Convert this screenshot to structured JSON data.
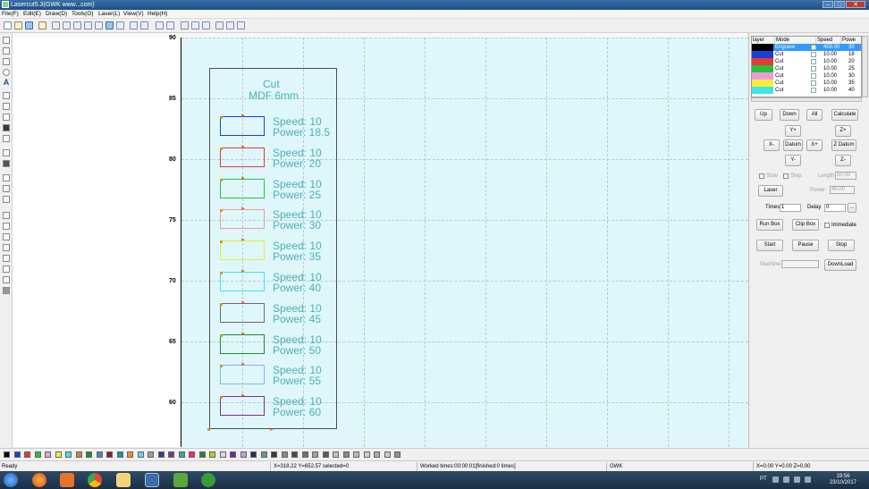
{
  "window": {
    "title": "Lasercut5.3(GWK www...com)",
    "min": "–",
    "max": "□",
    "close": "✕"
  },
  "menu": [
    "File(F)",
    "Edit(E)",
    "Draw(D)",
    "Tools(O)",
    "Laser(L)",
    "View(V)",
    "Help(H)"
  ],
  "ruler": {
    "labels": [
      "90",
      "85",
      "80",
      "75",
      "70",
      "65",
      "60"
    ]
  },
  "canvas": {
    "heading_line1": "Cut",
    "heading_line2": "MDF 6mm",
    "samples": [
      {
        "speed": "Speed: 10",
        "power": "Power: 18.5",
        "color": "#1a3fd6"
      },
      {
        "speed": "Speed: 10",
        "power": "Power: 20",
        "color": "#e53935"
      },
      {
        "speed": "Speed: 10",
        "power": "Power: 25",
        "color": "#22c33a"
      },
      {
        "speed": "Speed: 10",
        "power": "Power: 30",
        "color": "#ef9a9a"
      },
      {
        "speed": "Speed: 10",
        "power": "Power: 35",
        "color": "#e8e83a"
      },
      {
        "speed": "Speed: 10",
        "power": "Power: 40",
        "color": "#3ee6e6"
      },
      {
        "speed": "Speed: 10",
        "power": "Power: 45",
        "color": "#6b6b6b"
      },
      {
        "speed": "Speed: 10",
        "power": "Power: 50",
        "color": "#1e8c2a"
      },
      {
        "speed": "Speed: 10",
        "power": "Power: 55",
        "color": "#8fb0e0"
      },
      {
        "speed": "Speed: 10",
        "power": "Power: 60",
        "color": "#8a2a8a"
      }
    ]
  },
  "layers": {
    "headers": [
      "layer",
      "Mode",
      "Speed",
      "Powe"
    ],
    "rows": [
      {
        "color": "#000000",
        "mode": "Engrave",
        "speed": "400.00",
        "power": "30"
      },
      {
        "color": "#1a3fd6",
        "mode": "Cut",
        "speed": "10.00",
        "power": "18"
      },
      {
        "color": "#e53935",
        "mode": "Cut",
        "speed": "10.00",
        "power": "20"
      },
      {
        "color": "#22c33a",
        "mode": "Cut",
        "speed": "10.00",
        "power": "25"
      },
      {
        "color": "#ef9ad8",
        "mode": "Cut",
        "speed": "10.00",
        "power": "30"
      },
      {
        "color": "#f5f03a",
        "mode": "Cut",
        "speed": "10.00",
        "power": "35"
      },
      {
        "color": "#3ee6e6",
        "mode": "Cut",
        "speed": "10.00",
        "power": "40"
      }
    ]
  },
  "panel": {
    "up": "Up",
    "down": "Down",
    "all": "All",
    "calculate": "Calculate",
    "y_plus": "Y+",
    "z_plus": "Z+",
    "x_minus": "X-",
    "datum": "Datum",
    "x_plus": "X+",
    "z_datum": "Z Datum",
    "y_minus": "Y-",
    "z_minus": "Z-",
    "slow": "Slow",
    "step": "Step",
    "length_label": "Length",
    "length_value": "50.00",
    "laser": "Laser",
    "power_label": "Power",
    "power_value": "45.00",
    "times_label": "Times",
    "times_value": "1",
    "delay_label": "Delay",
    "delay_value": "0",
    "delay_more": "...",
    "run_box": "Run Box",
    "clip_box": "Clip Box",
    "immediate": "Immediate",
    "start": "Start",
    "pause": "Pause",
    "stop": "Stop",
    "machine_label": "Machine",
    "download": "DownLoad"
  },
  "palette": [
    "#000000",
    "#1a3fd6",
    "#e53935",
    "#22c33a",
    "#ef9ad8",
    "#f5f03a",
    "#3ee6e6",
    "#b58a4a",
    "#1e8c2a",
    "#5a7fb5",
    "#7a2a2a",
    "#2a8aa8",
    "#f28c28",
    "#6ad0ee",
    "#9b9b9b",
    "#3a3a8a",
    "#7a3a7a",
    "#2aa8a8",
    "#ee2a7a",
    "#3a7a3a",
    "#b0d030",
    "#e8d0e8",
    "#6a2aa8",
    "#c0a0d0",
    "#2a2a5a",
    "#5a9a9a",
    "#3a3a3a",
    "#8a8a8a",
    "#4a4a4a",
    "#707070",
    "#a0a0a0",
    "#5a5a5a",
    "#c0c0c0",
    "#888888",
    "#b8b8b8",
    "#d0d0d0",
    "#a8a8a8",
    "#c8c8c8",
    "#909090"
  ],
  "status": {
    "ready": "Ready",
    "coords": "X=318.22 Y=652.57 selected=0",
    "worked": "Worked times:00:00:01[finished:0 times]",
    "company": "GWK",
    "position": "X=0.00 Y=0.00 Z=0.00"
  },
  "taskbar": {
    "lang": "PT",
    "time": "19:56",
    "date": "23/10/2017"
  }
}
